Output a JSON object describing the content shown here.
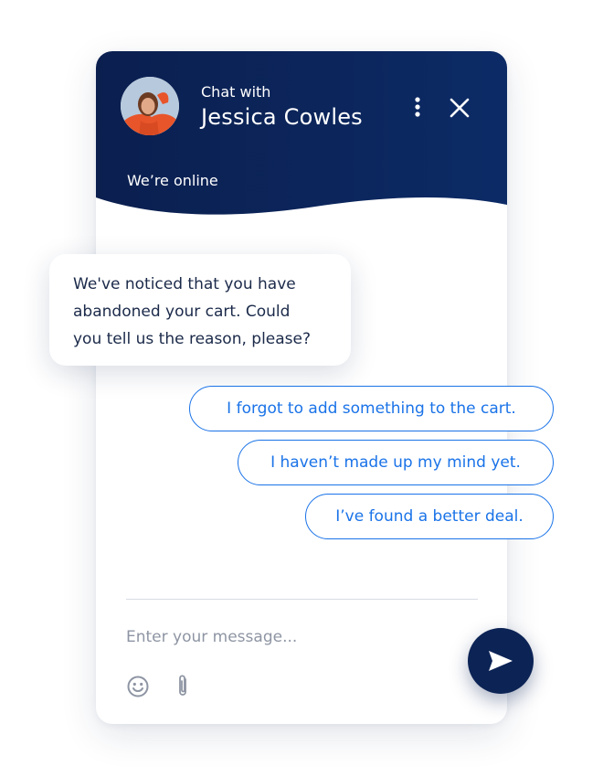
{
  "header": {
    "subtitle": "Chat with",
    "agent_name": "Jessica Cowles",
    "status": "We’re online"
  },
  "messages": {
    "bot": [
      "We've noticed that you have",
      "abandoned your cart. Could",
      "you tell us the reason, please?"
    ]
  },
  "quick_replies": [
    "I forgot to add something to the cart.",
    "I haven’t made up my mind yet.",
    "I’ve found a better deal."
  ],
  "composer": {
    "placeholder": "Enter your message..."
  },
  "colors": {
    "header_bg": "#0c2b66",
    "accent": "#1a73e8",
    "send_button": "#0c2355"
  },
  "icons": {
    "menu": "more-vertical-icon",
    "close": "close-icon",
    "emoji": "smiley-icon",
    "attach": "paperclip-icon",
    "send": "send-icon"
  }
}
